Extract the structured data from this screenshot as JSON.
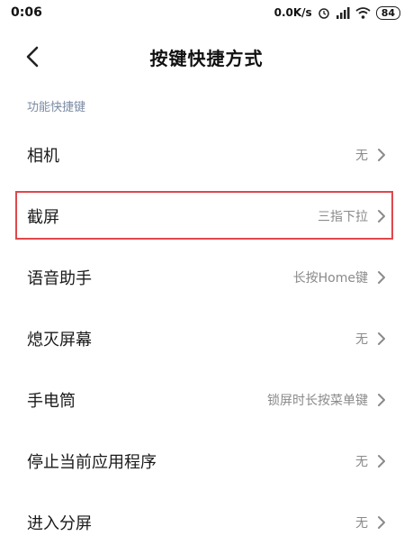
{
  "status_bar": {
    "time": "0:06",
    "network_speed": "0.0K/s",
    "battery": "84",
    "icons": [
      "alarm-icon",
      "signal-icon",
      "wifi-icon"
    ]
  },
  "header": {
    "back_icon": "chevron-left-icon",
    "title": "按键快捷方式"
  },
  "section": {
    "title": "功能快捷键"
  },
  "items": [
    {
      "label": "相机",
      "value": "无"
    },
    {
      "label": "截屏",
      "value": "三指下拉"
    },
    {
      "label": "语音助手",
      "value": "长按Home键"
    },
    {
      "label": "熄灭屏幕",
      "value": "无"
    },
    {
      "label": "手电筒",
      "value": "锁屏时长按菜单键"
    },
    {
      "label": "停止当前应用程序",
      "value": "无"
    },
    {
      "label": "进入分屏",
      "value": "无"
    }
  ],
  "highlight": {
    "color": "#e0474c",
    "item_index": 1
  },
  "colors": {
    "section_header": "#7b8aa3",
    "value_text": "#8a8a8a"
  }
}
